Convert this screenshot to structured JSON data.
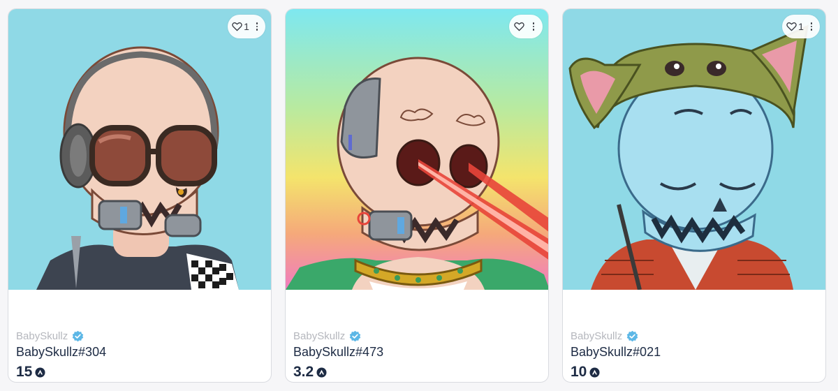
{
  "colors": {
    "art_bg_blue": "#8fd9e6",
    "skull": "#f3d2c0",
    "skull_blue": "#a8dff0",
    "laser": "#e8453a",
    "verified": "#5cb7e6",
    "text_dark": "#1d2b44",
    "text_muted": "#b5b7bd"
  },
  "cards": [
    {
      "collection": "BabySkullz",
      "token": "BabySkullz#304",
      "price": "15",
      "favorites": "1",
      "art": "skull with headphones and glasses",
      "icons": [
        "heart-icon",
        "more-icon",
        "verified-icon",
        "avax-icon"
      ]
    },
    {
      "collection": "BabySkullz",
      "token": "BabySkullz#473",
      "price": "3.2",
      "favorites": "",
      "art": "skull with laser eyes on rainbow background",
      "icons": [
        "heart-icon",
        "more-icon",
        "verified-icon",
        "avax-icon"
      ]
    },
    {
      "collection": "BabySkullz",
      "token": "BabySkullz#021",
      "price": "10",
      "favorites": "1",
      "art": "blue skull with green cat hood",
      "icons": [
        "heart-icon",
        "more-icon",
        "verified-icon",
        "avax-icon"
      ]
    }
  ]
}
